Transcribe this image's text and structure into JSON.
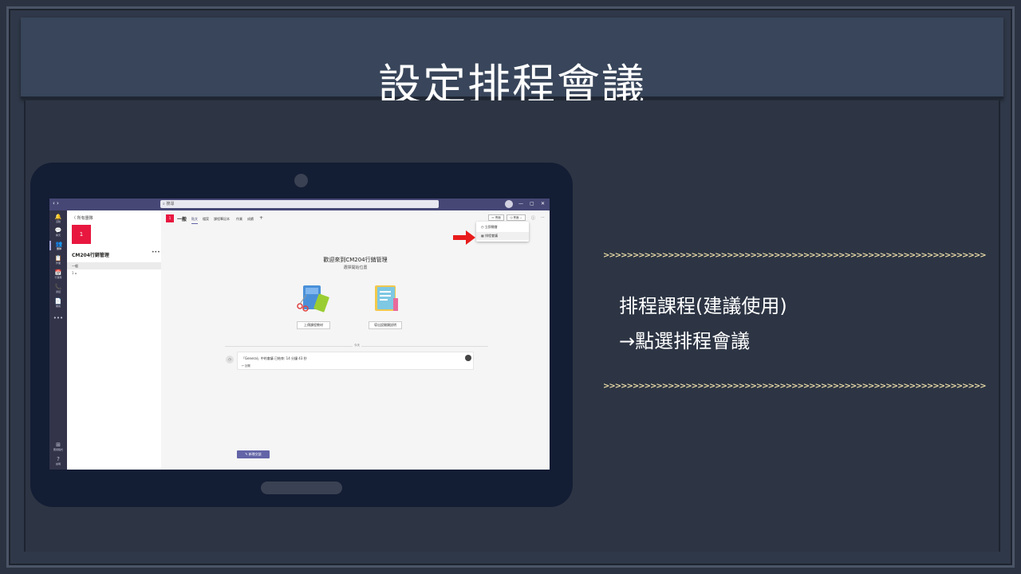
{
  "slide": {
    "title": "設定排程會議",
    "note_line1": "排程課程(建議使用)",
    "note_line2": "→點選排程會議",
    "decor": ">>>>>>>>>>>>>>>>>>>>>>>>>>>>>>>>>>>>>>>>>>>>>>>>>>>>>>>>>>>>>>>>>"
  },
  "teams": {
    "search_placeholder": "搜尋",
    "rail": [
      {
        "icon": "bell-icon",
        "glyph": "🔔",
        "label": "活動"
      },
      {
        "icon": "chat-icon",
        "glyph": "💬",
        "label": "聊天"
      },
      {
        "icon": "teams-icon",
        "glyph": "👥",
        "label": "團隊"
      },
      {
        "icon": "assignments-icon",
        "glyph": "📋",
        "label": "作業"
      },
      {
        "icon": "calendar-icon",
        "glyph": "📅",
        "label": "行事曆"
      },
      {
        "icon": "calls-icon",
        "glyph": "📞",
        "label": "通話"
      },
      {
        "icon": "files-icon",
        "glyph": "📄",
        "label": "檔案"
      },
      {
        "icon": "more-icon",
        "glyph": "•••",
        "label": ""
      }
    ],
    "rail_bottom": [
      {
        "icon": "apps-icon",
        "glyph": "⊞",
        "label": "應用程式"
      },
      {
        "icon": "help-icon",
        "glyph": "?",
        "label": "說明"
      }
    ],
    "back_label": "〈  所有團隊",
    "team_tile": "1",
    "team_name": "CM204行銷管理",
    "team_more": "•••",
    "channel_general": "一般",
    "channel_sub": "1  ⌂",
    "channel_tile": "1",
    "channel_name": "一般",
    "tabs": [
      "貼文",
      "檔案",
      "課程筆記本",
      "作業",
      "成績",
      "+"
    ],
    "meet_label": "▭ 會面",
    "meet_split_label": "◷ 會面  ⌄",
    "dropdown": {
      "item1": "◷  立即開會",
      "item2": "▦  排程會議"
    },
    "welcome_title": "歡迎來到CM204行銷管理",
    "welcome_subtitle": "選擇開始位置",
    "action_upload": "上傳課程教材",
    "action_notebook": "導出設開類說明",
    "today_label": "今天",
    "message_text": "「General」中的會議 已結束: 14 分鐘 43 秒",
    "message_reply": "↩ 回覆",
    "new_conversation": "✎  新增交談"
  },
  "colors": {
    "accent": "#6264a7",
    "team_tile": "#e8173f",
    "annotation_arrow": "#e81c1c",
    "decor": "#e8d9a6"
  }
}
